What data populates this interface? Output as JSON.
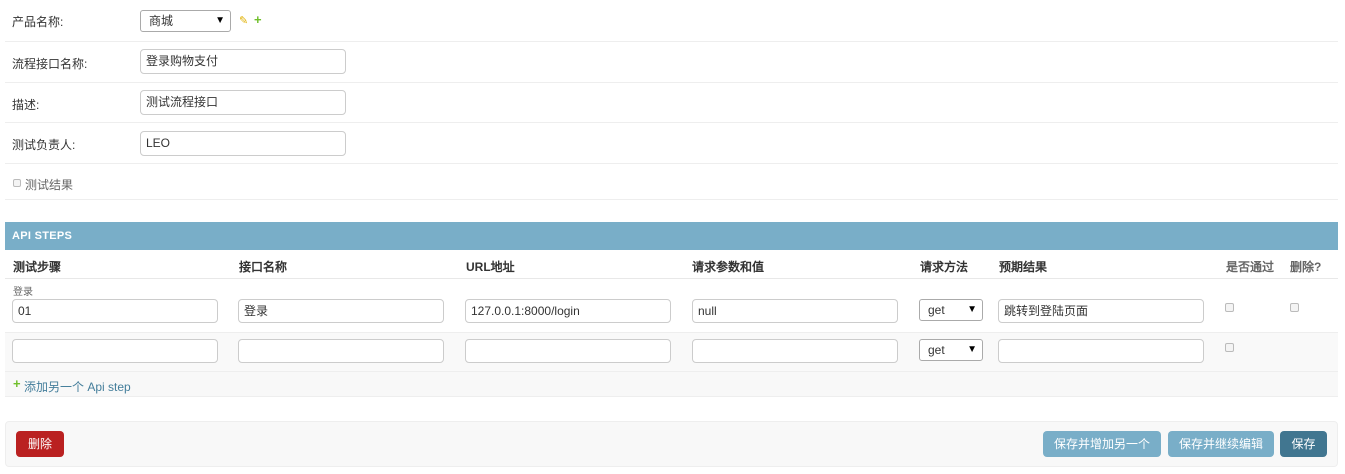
{
  "form": {
    "product": {
      "label": "产品名称:",
      "value": "商城"
    },
    "flow_name": {
      "label": "流程接口名称:",
      "value": "登录购物支付"
    },
    "description": {
      "label": "描述:",
      "value": "测试流程接口"
    },
    "tester": {
      "label": "测试负责人:",
      "value": "LEO"
    },
    "result_checkbox_label": "测试结果"
  },
  "api_steps": {
    "title": "API STEPS",
    "columns": [
      "测试步骤",
      "接口名称",
      "URL地址",
      "请求参数和值",
      "请求方法",
      "预期结果",
      "是否通过",
      "删除?"
    ],
    "partial_label": "登录",
    "rows": [
      {
        "step": "01",
        "name": "登录",
        "url": "127.0.0.1:8000/login",
        "params": "null",
        "method": "get",
        "expected": "跳转到登陆页面"
      },
      {
        "step": "",
        "name": "",
        "url": "",
        "params": "",
        "method": "get",
        "expected": ""
      }
    ],
    "add_link": "添加另一个 Api step"
  },
  "actions": {
    "delete": "删除",
    "save_add": "保存并增加另一个",
    "save_continue": "保存并继续编辑",
    "save": "保存"
  },
  "colors": {
    "header_bg": "#79aec8",
    "delete_btn": "#ba2121",
    "save_btn": "#417690",
    "link": "#447e9b",
    "add_icon": "#70bf2b"
  }
}
